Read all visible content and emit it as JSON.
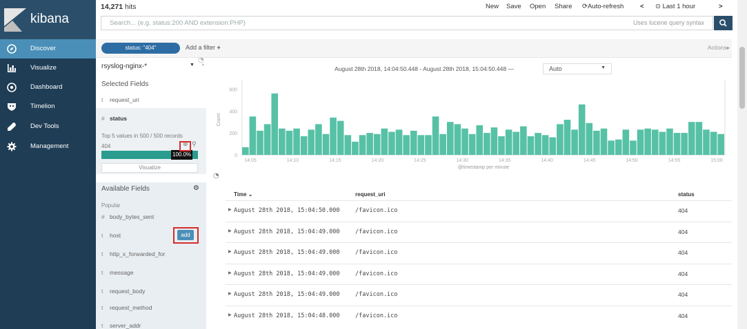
{
  "app": {
    "name": "kibana"
  },
  "nav": {
    "items": [
      {
        "label": "Discover",
        "icon": "compass-icon"
      },
      {
        "label": "Visualize",
        "icon": "bar-chart-icon"
      },
      {
        "label": "Dashboard",
        "icon": "dashboard-icon"
      },
      {
        "label": "Timelion",
        "icon": "shield-icon"
      },
      {
        "label": "Dev Tools",
        "icon": "wrench-icon"
      },
      {
        "label": "Management",
        "icon": "gear-icon"
      }
    ]
  },
  "header": {
    "hits": "14,271",
    "hits_suffix": "hits",
    "menu": {
      "new": "New",
      "save": "Save",
      "open": "Open",
      "share": "Share",
      "autorefresh": "Auto-refresh",
      "range": "Last 1 hour"
    }
  },
  "search": {
    "placeholder": "Search... (e.g. status:200 AND extension:PHP)",
    "hint": "Uses lucene query syntax"
  },
  "filter": {
    "pill": "status: \"404\"",
    "add": "Add a filter",
    "actions": "Actions"
  },
  "fields": {
    "index": "rsyslog-nginx-*",
    "selected_title": "Selected Fields",
    "selected": [
      {
        "type": "t",
        "name": "request_uri"
      }
    ],
    "status": {
      "type": "#",
      "name": "status",
      "top_text": "Top 5 values in 500 / 500 records",
      "value": "404",
      "percent_label": "100.0%",
      "percent": 100,
      "visualize": "Visualize"
    },
    "available_title": "Available Fields",
    "popular": "Popular",
    "available": [
      {
        "type": "#",
        "name": "body_bytes_sent"
      },
      {
        "type": "t",
        "name": "host"
      },
      {
        "type": "t",
        "name": "http_x_forwarded_for"
      },
      {
        "type": "t",
        "name": "message"
      },
      {
        "type": "t",
        "name": "request_body"
      },
      {
        "type": "t",
        "name": "request_method"
      },
      {
        "type": "t",
        "name": "server_addr"
      }
    ],
    "add_label": "add"
  },
  "chart_data": {
    "type": "bar",
    "title": "August 28th 2018, 14:04:50.448 - August 28th 2018, 15:04:50.448 —",
    "interval": "Auto",
    "xlabel": "@timestamp per minute",
    "ylabel": "Count",
    "yticks": [
      0,
      200,
      400,
      600
    ],
    "ylim": [
      0,
      640
    ],
    "xticks": [
      "14:05",
      "14:10",
      "14:15",
      "14:20",
      "14:25",
      "14:30",
      "14:35",
      "14:40",
      "14:45",
      "14:50",
      "14:55",
      "15:00"
    ],
    "values": [
      70,
      350,
      220,
      280,
      560,
      240,
      220,
      240,
      170,
      230,
      280,
      190,
      340,
      310,
      180,
      120,
      180,
      200,
      190,
      240,
      210,
      230,
      180,
      220,
      180,
      180,
      350,
      190,
      300,
      280,
      240,
      190,
      270,
      200,
      250,
      170,
      230,
      210,
      260,
      170,
      200,
      180,
      160,
      280,
      320,
      230,
      460,
      290,
      220,
      240,
      130,
      140,
      230,
      130,
      230,
      240,
      230,
      210,
      240,
      200,
      200,
      300,
      300,
      230,
      210,
      190
    ]
  },
  "table": {
    "headers": {
      "time": "Time",
      "uri": "request_uri",
      "status": "status"
    },
    "rows": [
      {
        "time": "August 28th 2018, 15:04:50.000",
        "uri": "/favicon.ico",
        "status": "404"
      },
      {
        "time": "August 28th 2018, 15:04:49.000",
        "uri": "/favicon.ico",
        "status": "404"
      },
      {
        "time": "August 28th 2018, 15:04:49.000",
        "uri": "/favicon.ico",
        "status": "404"
      },
      {
        "time": "August 28th 2018, 15:04:49.000",
        "uri": "/favicon.ico",
        "status": "404"
      },
      {
        "time": "August 28th 2018, 15:04:49.000",
        "uri": "/favicon.ico",
        "status": "404"
      },
      {
        "time": "August 28th 2018, 15:04:48.000",
        "uri": "/favicon.ico",
        "status": "404"
      }
    ]
  },
  "colors": {
    "nav_bg": "#1f3d55",
    "active": "#4a8fb8",
    "bar": "#57c1a6",
    "pill": "#2e6da4"
  }
}
